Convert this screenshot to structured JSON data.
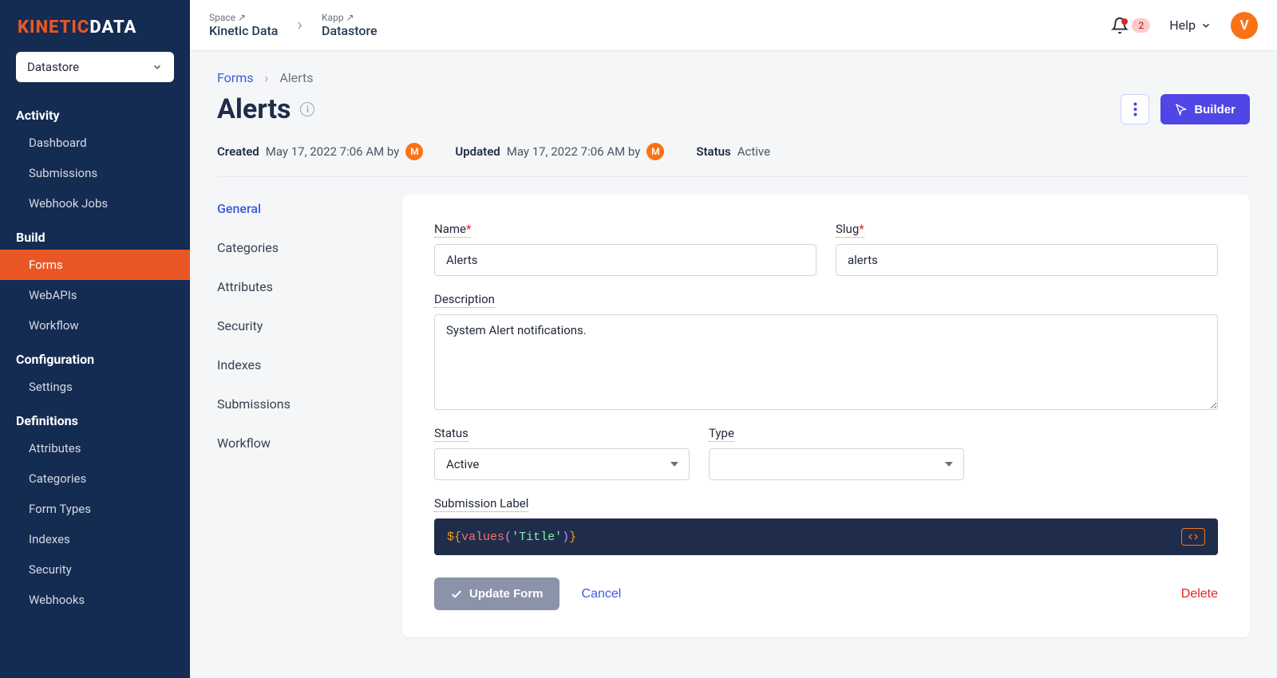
{
  "brand": {
    "part1": "KINETIC",
    "part2": "DATA"
  },
  "sidebarSelect": "Datastore",
  "sidebar": {
    "sections": [
      {
        "title": "Activity",
        "items": [
          "Dashboard",
          "Submissions",
          "Webhook Jobs"
        ]
      },
      {
        "title": "Build",
        "items": [
          "Forms",
          "WebAPIs",
          "Workflow"
        ],
        "activeIndex": 0
      },
      {
        "title": "Configuration",
        "items": [
          "Settings"
        ]
      },
      {
        "title": "Definitions",
        "items": [
          "Attributes",
          "Categories",
          "Form Types",
          "Indexes",
          "Security",
          "Webhooks"
        ]
      }
    ]
  },
  "topbar": {
    "space": {
      "label": "Space",
      "value": "Kinetic Data"
    },
    "kapp": {
      "label": "Kapp",
      "value": "Datastore"
    },
    "notifCount": "2",
    "help": "Help",
    "avatar": "V"
  },
  "breadcrumb": {
    "parent": "Forms",
    "current": "Alerts"
  },
  "pageTitle": "Alerts",
  "builderLabel": "Builder",
  "meta": {
    "created": {
      "label": "Created",
      "value": "May 17, 2022 7:06 AM by",
      "user": "M"
    },
    "updated": {
      "label": "Updated",
      "value": "May 17, 2022 7:06 AM by",
      "user": "M"
    },
    "status": {
      "label": "Status",
      "value": "Active"
    }
  },
  "sideTabs": [
    "General",
    "Categories",
    "Attributes",
    "Security",
    "Indexes",
    "Submissions",
    "Workflow"
  ],
  "activeTab": 0,
  "form": {
    "name": {
      "label": "Name",
      "value": "Alerts",
      "required": true
    },
    "slug": {
      "label": "Slug",
      "value": "alerts",
      "required": true
    },
    "description": {
      "label": "Description",
      "value": "System Alert notifications."
    },
    "status": {
      "label": "Status",
      "value": "Active"
    },
    "type": {
      "label": "Type",
      "value": ""
    },
    "submissionLabel": {
      "label": "Submission Label",
      "dollar": "$",
      "func": "values",
      "arg": "'Title'"
    }
  },
  "actions": {
    "update": "Update Form",
    "cancel": "Cancel",
    "delete": "Delete"
  }
}
